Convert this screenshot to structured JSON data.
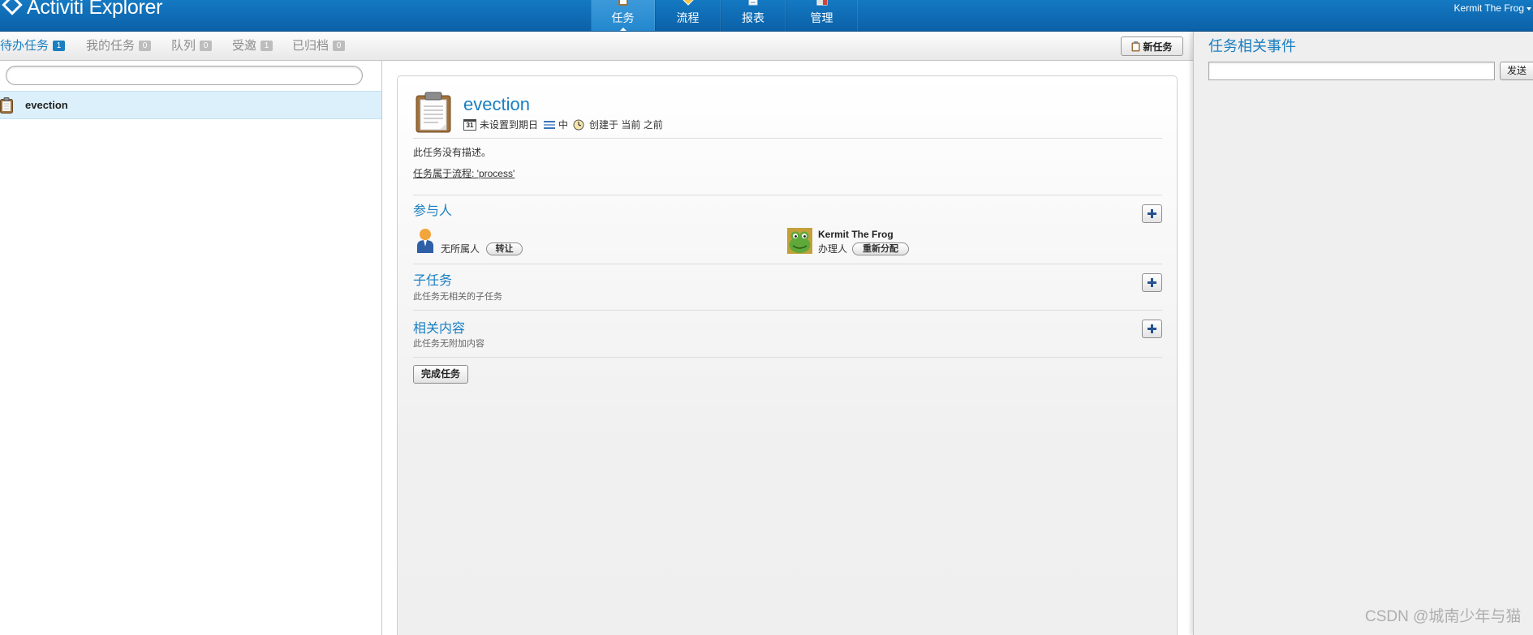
{
  "app": {
    "title": "Activiti Explorer",
    "user": "Kermit The Frog"
  },
  "nav": {
    "tabs": [
      {
        "label": "任务",
        "icon": "task-icon",
        "active": true
      },
      {
        "label": "流程",
        "icon": "process-icon",
        "active": false
      },
      {
        "label": "报表",
        "icon": "report-icon",
        "active": false
      },
      {
        "label": "管理",
        "icon": "admin-icon",
        "active": false
      }
    ]
  },
  "subnav": {
    "tabs": [
      {
        "label": "待办任务",
        "count": "1",
        "active": true
      },
      {
        "label": "我的任务",
        "count": "0",
        "active": false
      },
      {
        "label": "队列",
        "count": "0",
        "active": false
      },
      {
        "label": "受邀",
        "count": "1",
        "active": false
      },
      {
        "label": "已归档",
        "count": "0",
        "active": false
      }
    ],
    "new_task_label": "新任务"
  },
  "task_list": {
    "items": [
      {
        "name": "evection",
        "icon": "clipboard-icon",
        "selected": true
      }
    ]
  },
  "task": {
    "title": "evection",
    "calendar_icon_text": "31",
    "due": "未设置到期日",
    "priority": "中",
    "created": "创建于 当前 之前",
    "description": "此任务没有描述。",
    "process_link": "任务属于流程: 'process'",
    "people": {
      "heading": "参与人",
      "owner": {
        "label": "无所属人",
        "action": "转让"
      },
      "assignee": {
        "name": "Kermit The Frog",
        "role": "办理人",
        "action": "重新分配"
      }
    },
    "subtasks": {
      "heading": "子任务",
      "empty": "此任务无相关的子任务"
    },
    "related": {
      "heading": "相关内容",
      "empty": "此任务无附加内容"
    },
    "complete_label": "完成任务"
  },
  "events": {
    "heading": "任务相关事件",
    "send_label": "发送"
  },
  "watermark": "CSDN @城南少年与猫",
  "colors": {
    "topbar": "#0e6cb6",
    "accent": "#1a7fc1",
    "selected_row": "#dcf0fb",
    "side_panel": "#efefef"
  }
}
